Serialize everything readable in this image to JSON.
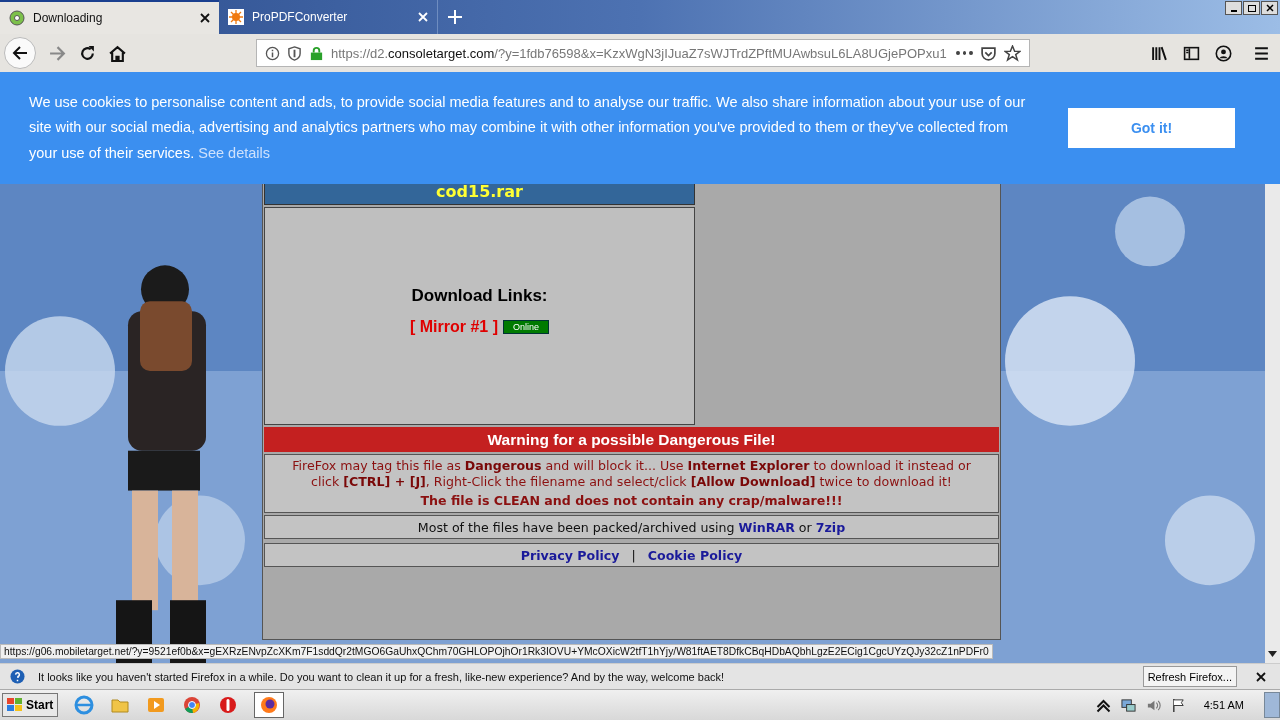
{
  "tabs": [
    {
      "title": "Downloading",
      "selected": true
    },
    {
      "title": "ProPDFConverter",
      "selected": false
    }
  ],
  "address": {
    "prefix": "https://d2.",
    "domain": "consoletarget.com",
    "rest": "/?y=1fdb76598&x=KzxWgN3jIJuaZ7sWJTrdZPftMUAwbsuL6LA8UGjePOPxu1"
  },
  "cookie_banner": {
    "text": "We use cookies to personalise content and ads, to provide social media features and to analyse our traffic. We also share information about your use of our site with our social media, advertising and analytics partners who may combine it with other information you've provided to them or they've collected from your use of their services.",
    "link": "See details",
    "button": "Got it!"
  },
  "file_title": "cod15.rar",
  "download": {
    "heading": "Download Links:",
    "mirror": "[ Mirror #1 ]",
    "status": "Online"
  },
  "warning": {
    "title": "Warning for a possible Dangerous File!",
    "text": "FireFox may tag this file as **Dangerous** and will block it... Use **Internet Explorer** to download it instead or click **[CTRL] + [J]**, Right-Click the filename and select/click **[Allow Download]** twice to download it!",
    "clean": "The file is CLEAN and does not contain any crap/malware!!!"
  },
  "archive": {
    "text": "Most of the files have been packed/archived using",
    "link_1": "WinRAR",
    "joiner": "or",
    "link_2": "7zip"
  },
  "footer_links": [
    "Privacy Policy",
    "Cookie Policy"
  ],
  "footer_separator": "|",
  "status_url": "https://g06.mobiletarget.net/?y=9521ef0b&x=gEXRzENvpZcXKm7F1sddQr2tMGO6GaUhxQChm70GHLOPOjhOr1Rk3IOVU+YMcOXicW2tfT1hYjy/W81ftAET8DfkCBqHDbAQbhLgzE2ECig1CgcUYzQJy32cZ1nPDFr0",
  "notification": {
    "text": "It looks like you haven't started Firefox in a while. Do you want to clean it up for a fresh, like-new experience? And by the way, welcome back!",
    "button": "Refresh Firefox..."
  },
  "taskbar": {
    "start": "Start",
    "clock": "4:51 AM"
  }
}
